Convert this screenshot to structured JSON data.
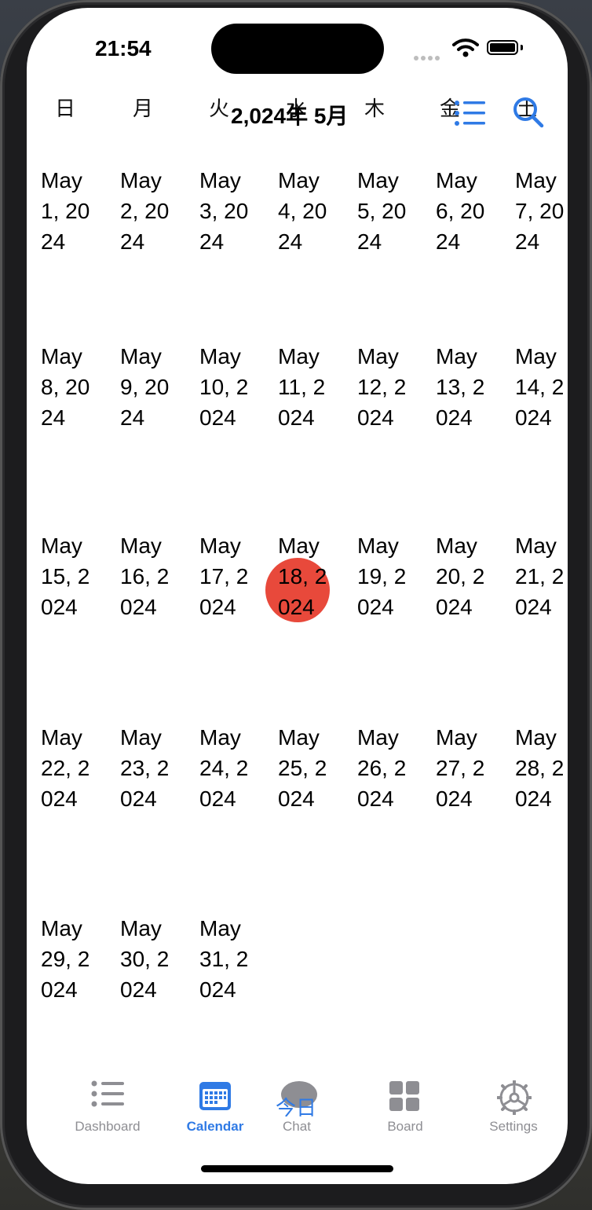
{
  "status_bar": {
    "time": "21:54"
  },
  "header": {
    "title": "2,024年 5月",
    "weekdays": [
      "日",
      "月",
      "火",
      "水",
      "木",
      "金",
      "土"
    ]
  },
  "calendar": {
    "days": [
      "May 1, 2024",
      "May 2, 2024",
      "May 3, 2024",
      "May 4, 2024",
      "May 5, 2024",
      "May 6, 2024",
      "May 7, 2024",
      "May 8, 2024",
      "May 9, 2024",
      "May 10, 2024",
      "May 11, 2024",
      "May 12, 2024",
      "May 13, 2024",
      "May 14, 2024",
      "May 15, 2024",
      "May 16, 2024",
      "May 17, 2024",
      "May 18, 2024",
      "May 19, 2024",
      "May 20, 2024",
      "May 21, 2024",
      "May 22, 2024",
      "May 23, 2024",
      "May 24, 2024",
      "May 25, 2024",
      "May 26, 2024",
      "May 27, 2024",
      "May 28, 2024",
      "May 29, 2024",
      "May 30, 2024",
      "May 31, 2024"
    ],
    "selected_day": "May 18, 2024",
    "highlight_color": "#e8493b"
  },
  "today_button": {
    "label": "今日"
  },
  "tabbar": {
    "accent_color": "#2f7ae5",
    "items": [
      {
        "label": "Dashboard",
        "icon": "list-icon"
      },
      {
        "label": "Calendar",
        "icon": "calendar-icon",
        "active": true
      },
      {
        "label": "Chat",
        "icon": "chat-bubble-icon"
      },
      {
        "label": "Board",
        "icon": "grid-icon"
      },
      {
        "label": "Settings",
        "icon": "gear-icon"
      }
    ]
  }
}
